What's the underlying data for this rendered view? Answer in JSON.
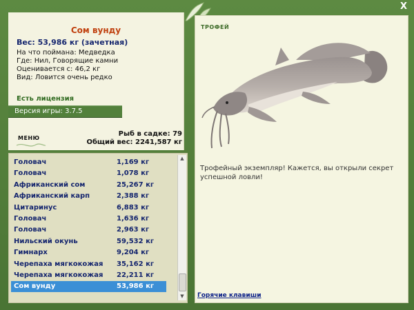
{
  "close_label": "X",
  "fish": {
    "name": "Сом вунду",
    "weight_line": "Вес: 53,986 кг (зачетная)",
    "bait": "На что поймана: Медведка",
    "location": "Где: Нил, Говорящие камни",
    "value": "Оценивается с: 46,2 кг",
    "rarity": "Вид: Ловится очень редко"
  },
  "license": "Есть лицензия",
  "version": "Версия игры: 3.7.5",
  "menu_label": "МЕНЮ",
  "stats": {
    "fish_in_cage": "Рыб в садке: 79",
    "total_weight": "Общий вес: 2241,587 кг"
  },
  "catch_list": [
    {
      "name": "Головач",
      "weight": "1,169 кг"
    },
    {
      "name": "Головач",
      "weight": "1,078 кг"
    },
    {
      "name": "Африканский сом",
      "weight": "25,267 кг"
    },
    {
      "name": "Африканский карп",
      "weight": "2,388 кг"
    },
    {
      "name": "Цитаринус",
      "weight": "6,883 кг"
    },
    {
      "name": "Головач",
      "weight": "1,636 кг"
    },
    {
      "name": "Головач",
      "weight": "2,963 кг"
    },
    {
      "name": "Нильский окунь",
      "weight": "59,532 кг"
    },
    {
      "name": "Гимнарх",
      "weight": "9,204 кг"
    },
    {
      "name": "Черепаха мягкокожая",
      "weight": "35,162 кг"
    },
    {
      "name": "Черепаха мягкокожая",
      "weight": "22,211 кг"
    },
    {
      "name": "Сом вунду",
      "weight": "53,986 кг"
    }
  ],
  "trophy": {
    "label": "ТРОФЕЙ",
    "message": "Трофейный экземпляр! Кажется, вы открыли секрет успешной ловли!",
    "hotkeys": "Горячие клавиши"
  },
  "colors": {
    "frame_green": "#4f7a37",
    "panel_bg": "#f4f3e1",
    "title_orange": "#c0400e",
    "navy_text": "#14256e",
    "selected_row": "#3b8fd6"
  }
}
